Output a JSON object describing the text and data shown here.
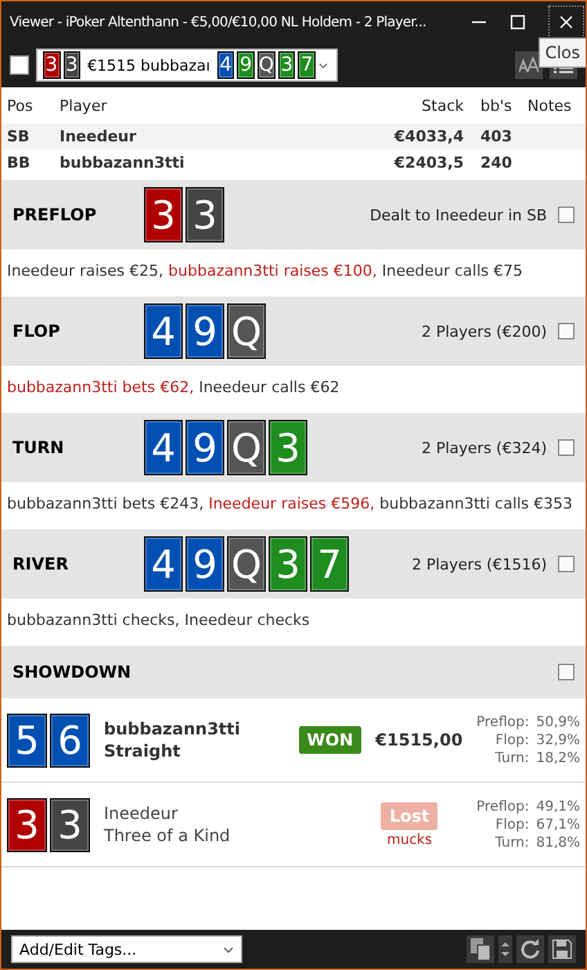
{
  "window": {
    "title": "Viewer - iPoker Altenthann - €5,00/€10,00 NL Holdem - 2 Player...",
    "tooltip": "Clos"
  },
  "toolbar": {
    "checked": false,
    "hand_cards": [
      {
        "rank": "3",
        "color": "#b00000"
      },
      {
        "rank": "3",
        "color": "#444444"
      }
    ],
    "summary": "€1515 bubbazaı",
    "board_cards": [
      {
        "rank": "4",
        "color": "#0050b4"
      },
      {
        "rank": "9",
        "color": "#1e8c1e"
      },
      {
        "rank": "Q",
        "color": "#555555"
      },
      {
        "rank": "3",
        "color": "#1e8c1e"
      },
      {
        "rank": "7",
        "color": "#1e8c1e"
      }
    ]
  },
  "table": {
    "columns": [
      "Pos",
      "Player",
      "Stack",
      "bb's",
      "Notes"
    ],
    "rows": [
      {
        "pos": "SB",
        "player": "Ineedeur",
        "stack": "€4033,4",
        "bbs": "403"
      },
      {
        "pos": "BB",
        "player": "bubbazann3tti",
        "stack": "€2403,5",
        "bbs": "240"
      }
    ]
  },
  "streets": [
    {
      "name": "PREFLOP",
      "cards": [
        {
          "rank": "3",
          "color": "#b00000"
        },
        {
          "rank": "3",
          "color": "#444444"
        }
      ],
      "info": "Dealt to Ineedeur in SB",
      "actions": [
        {
          "text": "Ineedeur raises €25, ",
          "highlight": false
        },
        {
          "text": "bubbazann3tti raises €100, ",
          "highlight": true
        },
        {
          "text": "Ineedeur calls €75",
          "highlight": false
        }
      ]
    },
    {
      "name": "FLOP",
      "cards": [
        {
          "rank": "4",
          "color": "#0050b4"
        },
        {
          "rank": "9",
          "color": "#0050b4"
        },
        {
          "rank": "Q",
          "color": "#555555"
        }
      ],
      "info": "2 Players (€200)",
      "actions": [
        {
          "text": "bubbazann3tti bets €62, ",
          "highlight": true
        },
        {
          "text": "Ineedeur calls €62",
          "highlight": false
        }
      ]
    },
    {
      "name": "TURN",
      "cards": [
        {
          "rank": "4",
          "color": "#0050b4"
        },
        {
          "rank": "9",
          "color": "#0050b4"
        },
        {
          "rank": "Q",
          "color": "#555555"
        },
        {
          "rank": "3",
          "color": "#1e8c1e"
        }
      ],
      "info": "2 Players (€324)",
      "actions": [
        {
          "text": "bubbazann3tti bets €243, ",
          "highlight": false
        },
        {
          "text": "Ineedeur raises €596, ",
          "highlight": true
        },
        {
          "text": "bubbazann3tti calls €353",
          "highlight": false
        }
      ]
    },
    {
      "name": "RIVER",
      "cards": [
        {
          "rank": "4",
          "color": "#0050b4"
        },
        {
          "rank": "9",
          "color": "#0050b4"
        },
        {
          "rank": "Q",
          "color": "#555555"
        },
        {
          "rank": "3",
          "color": "#1e8c1e"
        },
        {
          "rank": "7",
          "color": "#1e8c1e"
        }
      ],
      "info": "2 Players (€1516)",
      "actions": [
        {
          "text": "bubbazann3tti checks, Ineedeur checks",
          "highlight": false
        }
      ]
    }
  ],
  "showdown": {
    "title": "SHOWDOWN",
    "players": [
      {
        "cards": [
          {
            "rank": "5",
            "color": "#0050b4"
          },
          {
            "rank": "6",
            "color": "#0050b4"
          }
        ],
        "name": "bubbazann3tti",
        "hand": "Straight",
        "winner": true,
        "result": "WON",
        "amount": "€1515,00",
        "equity": [
          {
            "label": "Preflop:",
            "value": "50,9%"
          },
          {
            "label": "Flop:",
            "value": "32,9%"
          },
          {
            "label": "Turn:",
            "value": "18,2%"
          }
        ]
      },
      {
        "cards": [
          {
            "rank": "3",
            "color": "#b00000"
          },
          {
            "rank": "3",
            "color": "#444444"
          }
        ],
        "name": "Ineedeur",
        "hand": "Three of a Kind",
        "winner": false,
        "result": "Lost",
        "amount": "mucks",
        "equity": [
          {
            "label": "Preflop:",
            "value": "49,1%"
          },
          {
            "label": "Flop:",
            "value": "67,1%"
          },
          {
            "label": "Turn:",
            "value": "81,8%"
          }
        ]
      }
    ]
  },
  "footer": {
    "tags_placeholder": "Add/Edit Tags..."
  }
}
